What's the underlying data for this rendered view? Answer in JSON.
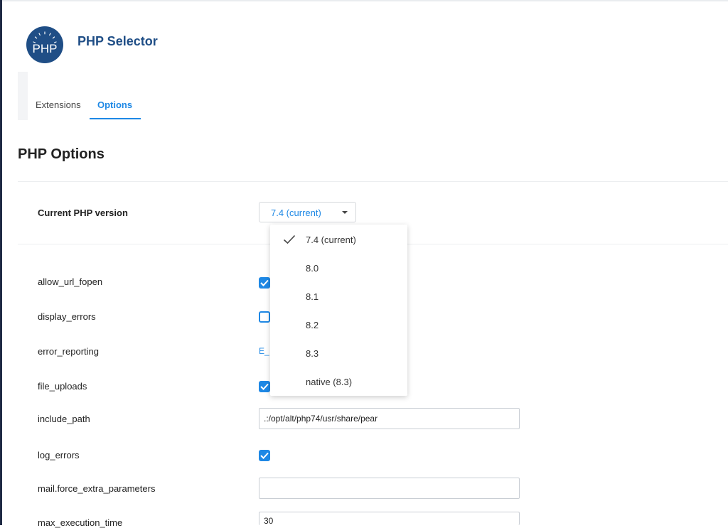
{
  "app": {
    "title": "PHP Selector",
    "logo_text": "PHP",
    "brand_color": "#1f4e86",
    "accent_color": "#1e88e5"
  },
  "tabs": [
    {
      "label": "Extensions",
      "active": false
    },
    {
      "label": "Options",
      "active": true
    }
  ],
  "section": {
    "title": "PHP Options"
  },
  "php_version": {
    "label": "Current PHP version",
    "selected": "7.4 (current)",
    "options": [
      {
        "label": "7.4 (current)",
        "checked": true
      },
      {
        "label": "8.0",
        "checked": false
      },
      {
        "label": "8.1",
        "checked": false
      },
      {
        "label": "8.2",
        "checked": false
      },
      {
        "label": "8.3",
        "checked": false
      },
      {
        "label": "native (8.3)",
        "checked": false
      }
    ]
  },
  "options": {
    "allow_url_fopen": {
      "label": "allow_url_fopen",
      "checked": true
    },
    "display_errors": {
      "label": "display_errors",
      "checked": false
    },
    "error_reporting": {
      "label": "error_reporting",
      "value": "E_"
    },
    "file_uploads": {
      "label": "file_uploads",
      "checked": true
    },
    "include_path": {
      "label": "include_path",
      "value": ".:/opt/alt/php74/usr/share/pear"
    },
    "log_errors": {
      "label": "log_errors",
      "checked": true
    },
    "mail_force_extra_parameters": {
      "label": "mail.force_extra_parameters",
      "value": ""
    },
    "max_execution_time": {
      "label": "max_execution_time",
      "value": "30"
    }
  }
}
